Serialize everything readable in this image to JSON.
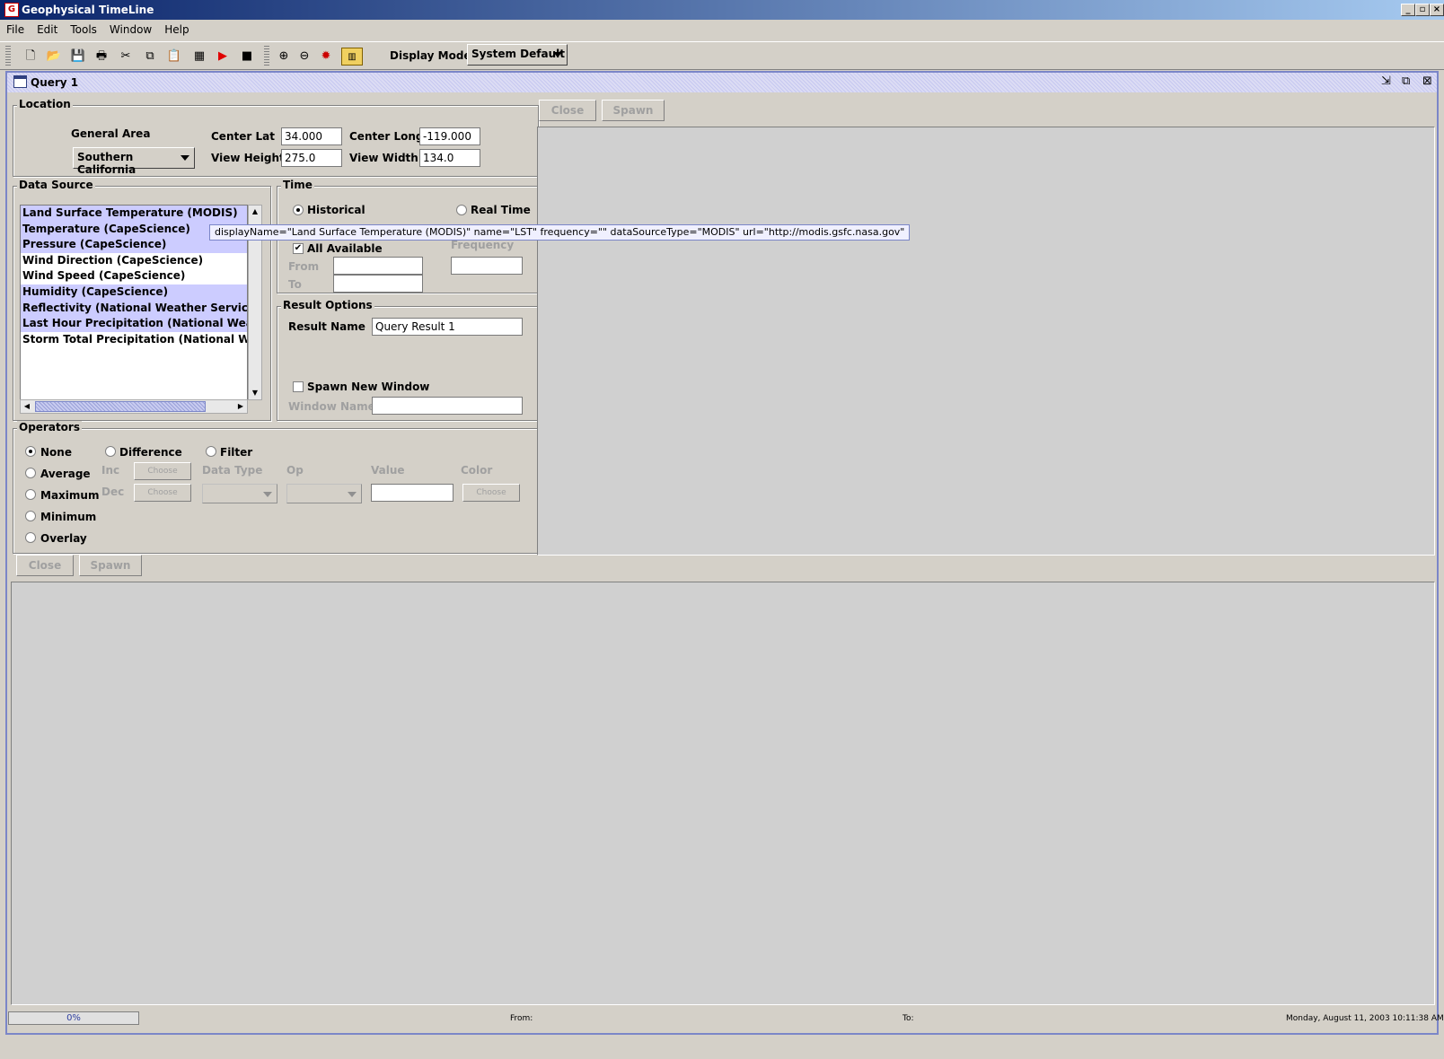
{
  "app": {
    "title": "Geophysical TimeLine"
  },
  "menu": [
    "File",
    "Edit",
    "Tools",
    "Window",
    "Help"
  ],
  "toolbar": {
    "icons": [
      "new-icon",
      "open-icon",
      "save-icon",
      "print-icon",
      "cut-icon",
      "copy-icon",
      "paste-icon",
      "table-icon",
      "play-icon",
      "stop-icon",
      "zoom-in-icon",
      "zoom-out-icon",
      "settings-icon",
      "chart-icon"
    ],
    "display_mode_label": "Display Mode",
    "display_mode_value": "System Default"
  },
  "frame": {
    "title": "Query 1"
  },
  "location": {
    "legend": "Location",
    "general_area_label": "General Area",
    "general_area_value": "Southern California",
    "center_lat_label": "Center Lat",
    "center_lat": "34.000",
    "center_long_label": "Center Long",
    "center_long": "-119.000",
    "view_height_label": "View Height",
    "view_height": "275.0",
    "view_width_label": "View Width",
    "view_width": "134.0"
  },
  "data_source": {
    "legend": "Data Source",
    "items": [
      {
        "label": "Land Surface Temperature (MODIS)",
        "selected": true
      },
      {
        "label": "Temperature (CapeScience)",
        "selected": true
      },
      {
        "label": "Pressure (CapeScience)",
        "selected": true
      },
      {
        "label": "Wind Direction (CapeScience)",
        "selected": false
      },
      {
        "label": "Wind Speed (CapeScience)",
        "selected": false
      },
      {
        "label": "Humidity (CapeScience)",
        "selected": true
      },
      {
        "label": "Reflectivity (National Weather Service)",
        "selected": true
      },
      {
        "label": "Last Hour Precipitation (National Weather Service)",
        "selected": true
      },
      {
        "label": "Storm Total Precipitation (National Weather Service)",
        "selected": false
      }
    ],
    "tooltip": "displayName=\"Land Surface Temperature (MODIS)\" name=\"LST\" frequency=\"\" dataSourceType=\"MODIS\" url=\"http://modis.gsfc.nasa.gov\""
  },
  "time": {
    "legend": "Time",
    "historical_label": "Historical",
    "realtime_label": "Real Time",
    "all_available_label": "All Available",
    "frequency_label": "Frequency",
    "from_label": "From",
    "to_label": "To"
  },
  "result": {
    "legend": "Result Options",
    "result_name_label": "Result Name",
    "result_name": "Query Result 1",
    "spawn_label": "Spawn New Window",
    "window_name_label": "Window Name"
  },
  "operators": {
    "legend": "Operators",
    "none": "None",
    "difference": "Difference",
    "filter": "Filter",
    "average": "Average",
    "maximum": "Maximum",
    "minimum": "Minimum",
    "overlay": "Overlay",
    "inc": "Inc",
    "dec": "Dec",
    "choose": "Choose",
    "data_type": "Data Type",
    "op": "Op",
    "value": "Value",
    "color": "Color"
  },
  "panel_buttons": {
    "close": "Close",
    "spawn": "Spawn"
  },
  "status": {
    "progress": "0%",
    "from_label": "From:",
    "to_label": "To:",
    "datetime": "Monday, August 11, 2003 10:11:38 AM"
  }
}
